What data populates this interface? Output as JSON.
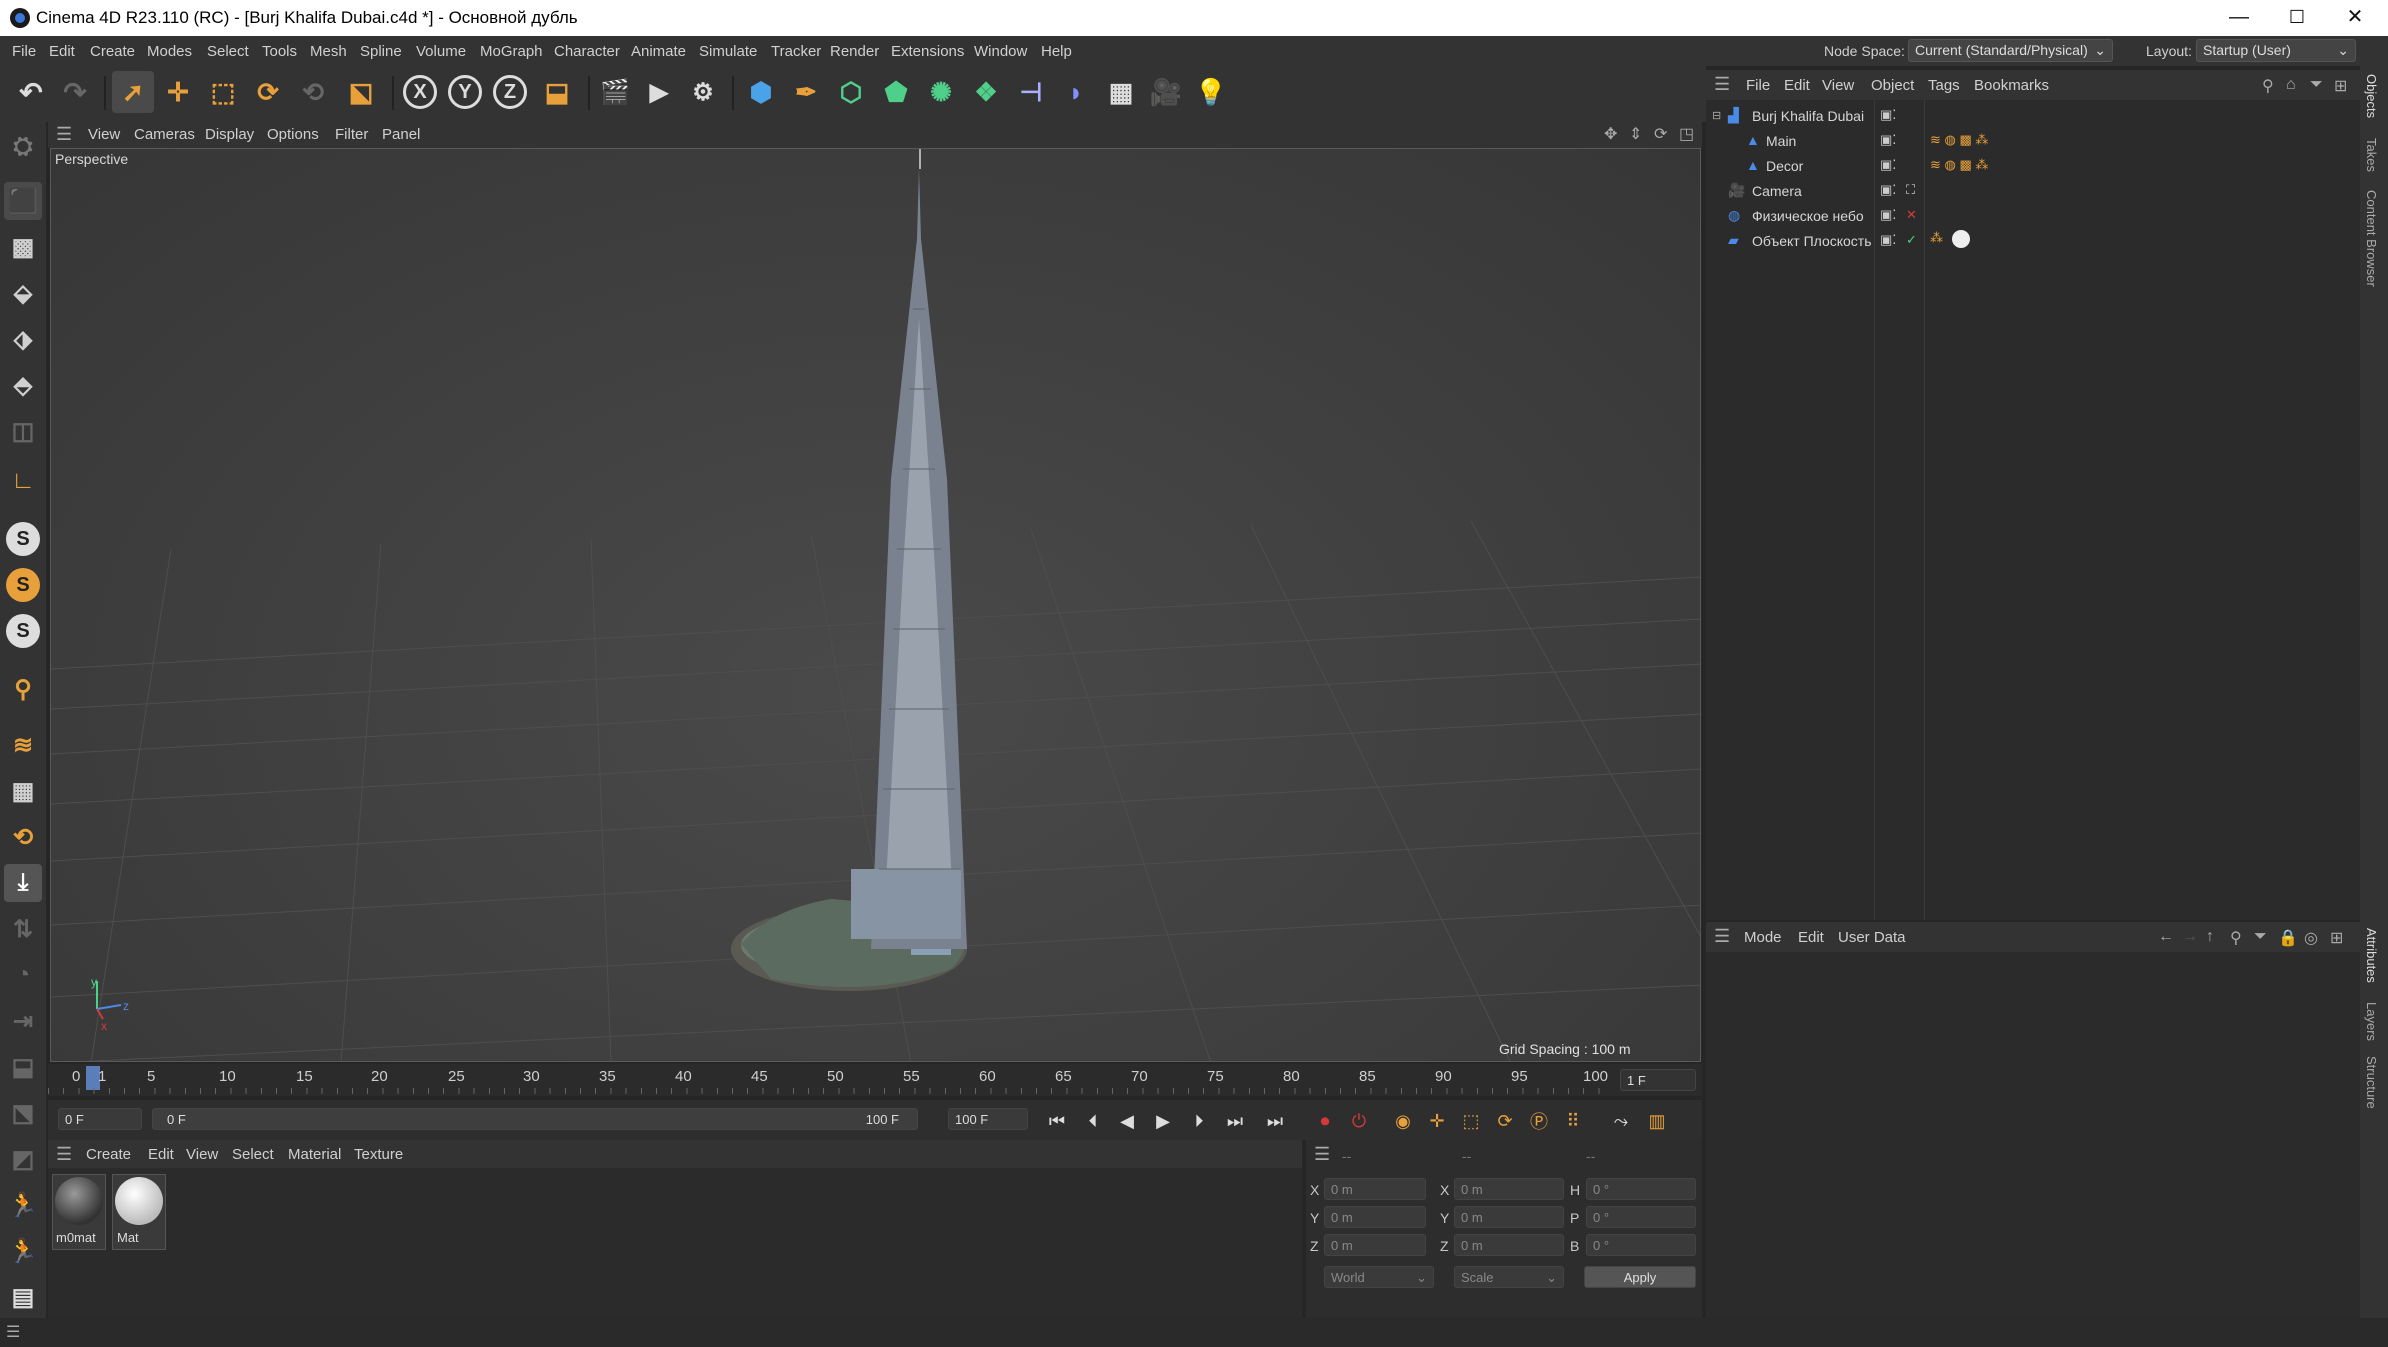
{
  "window": {
    "title": "Cinema 4D R23.110 (RC) - [Burj Khalifa Dubai.c4d *] - Основной дубль",
    "minimize": "—",
    "maximize": "☐",
    "close": "✕"
  },
  "menubar": {
    "items": [
      "File",
      "Edit",
      "Create",
      "Modes",
      "Select",
      "Tools",
      "Mesh",
      "Spline",
      "Volume",
      "MoGraph",
      "Character",
      "Animate",
      "Simulate",
      "Tracker",
      "Render",
      "Extensions",
      "Window",
      "Help"
    ],
    "node_space_label": "Node Space:",
    "node_space_value": "Current (Standard/Physical)",
    "layout_label": "Layout:",
    "layout_value": "Startup (User)"
  },
  "toolbar": {
    "axis_x": "X",
    "axis_y": "Y",
    "axis_z": "Z"
  },
  "left_toolbar": {
    "snap_s1": "S",
    "snap_s2": "S",
    "snap_s3": "S"
  },
  "viewport": {
    "menu": [
      "View",
      "Cameras",
      "Display",
      "Options",
      "Filter",
      "Panel"
    ],
    "name": "Perspective",
    "grid_spacing": "Grid Spacing : 100 m",
    "axis_y": "y",
    "axis_z": "z",
    "axis_x": "x"
  },
  "timeline": {
    "ticks": [
      "0",
      "1",
      "5",
      "10",
      "15",
      "20",
      "25",
      "30",
      "35",
      "40",
      "45",
      "50",
      "55",
      "60",
      "65",
      "70",
      "75",
      "80",
      "85",
      "90",
      "95",
      "100"
    ],
    "current_frame_field": "1 F",
    "start_field": "0 F",
    "range_start": "0 F",
    "range_end": "100 F",
    "end_field": "100 F"
  },
  "material_manager": {
    "menu": [
      "Create",
      "Edit",
      "View",
      "Select",
      "Material",
      "Texture"
    ],
    "materials": [
      {
        "name": "m0mat"
      },
      {
        "name": "Mat"
      }
    ]
  },
  "coordinates": {
    "col_headers": [
      "--",
      "--",
      "--"
    ],
    "rows": [
      {
        "pos_label": "X",
        "pos": "0 m",
        "size_label": "X",
        "size": "0 m",
        "rot_label": "H",
        "rot": "0 °"
      },
      {
        "pos_label": "Y",
        "pos": "0 m",
        "size_label": "Y",
        "size": "0 m",
        "rot_label": "P",
        "rot": "0 °"
      },
      {
        "pos_label": "Z",
        "pos": "0 m",
        "size_label": "Z",
        "size": "0 m",
        "rot_label": "B",
        "rot": "0 °"
      }
    ],
    "space": "World",
    "mode": "Scale",
    "apply": "Apply"
  },
  "object_manager": {
    "menu": [
      "File",
      "Edit",
      "View",
      "Object",
      "Tags",
      "Bookmarks"
    ],
    "objects": [
      {
        "name": "Burj Khalifa Dubai",
        "level": 0
      },
      {
        "name": "Main",
        "level": 1
      },
      {
        "name": "Decor",
        "level": 1
      },
      {
        "name": "Camera",
        "level": 0
      },
      {
        "name": "Физическое небо",
        "level": 0
      },
      {
        "name": "Объект Плоскость",
        "level": 0
      }
    ]
  },
  "attribute_manager": {
    "menu": [
      "Mode",
      "Edit",
      "User Data"
    ]
  },
  "right_tabs": {
    "top": [
      "Objects",
      "Takes",
      "Content Browser"
    ],
    "bottom": [
      "Attributes",
      "Layers",
      "Structure"
    ]
  },
  "colors": {
    "accent_blue": "#3b78d8",
    "accent_orange": "#e8a13a",
    "panel_bg": "#2b2b2b",
    "header_bg": "#333333",
    "viewport_bg": "#424242",
    "record_red": "#d23a3a"
  }
}
